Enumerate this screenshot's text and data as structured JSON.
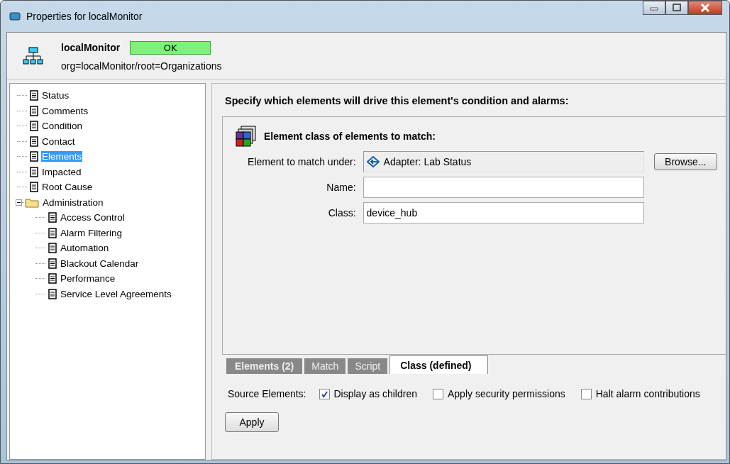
{
  "window": {
    "title": "Properties for localMonitor"
  },
  "header": {
    "name": "localMonitor",
    "status": "OK",
    "path": "org=localMonitor/root=Organizations"
  },
  "tree": [
    {
      "label": "Status",
      "selected": false
    },
    {
      "label": "Comments",
      "selected": false
    },
    {
      "label": "Condition",
      "selected": false
    },
    {
      "label": "Contact",
      "selected": false
    },
    {
      "label": "Elements",
      "selected": true
    },
    {
      "label": "Impacted",
      "selected": false
    },
    {
      "label": "Root Cause",
      "selected": false
    },
    {
      "label": "Administration",
      "selected": false,
      "expanded": true,
      "children": [
        {
          "label": "Access Control",
          "selected": false
        },
        {
          "label": "Alarm Filtering",
          "selected": false
        },
        {
          "label": "Automation",
          "selected": false
        },
        {
          "label": "Blackout Calendar",
          "selected": false
        },
        {
          "label": "Performance",
          "selected": false
        },
        {
          "label": "Service Level Agreements",
          "selected": false
        }
      ]
    }
  ],
  "panel": {
    "heading": "Specify which elements will drive this element's condition and alarms:",
    "group_title": "Element class of elements to match:",
    "match_under_label": "Element to match under:",
    "match_under_value": "Adapter: Lab Status",
    "browse_button": "Browse...",
    "name_label": "Name:",
    "class_label": "Class:",
    "class_value": "device_hub"
  },
  "tabs": [
    {
      "label": "Elements (2)",
      "selected": false
    },
    {
      "label": "Match",
      "selected": false
    },
    {
      "label": "Script",
      "selected": false
    },
    {
      "label": "Class (defined)",
      "selected": true
    }
  ],
  "source_label": "Source Elements:",
  "options": [
    {
      "label": "Display as children",
      "checked": true
    },
    {
      "label": "Apply security permissions",
      "checked": false
    },
    {
      "label": "Halt alarm contributions",
      "checked": false
    }
  ],
  "apply_button": "Apply"
}
